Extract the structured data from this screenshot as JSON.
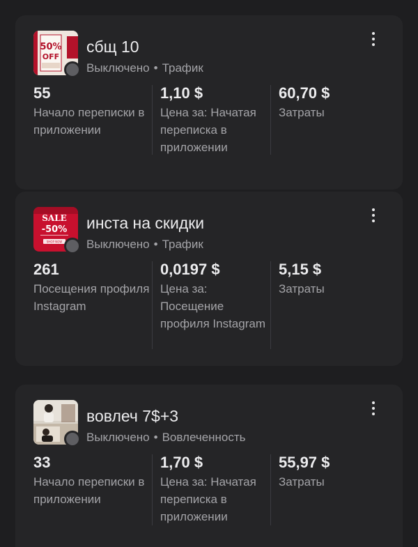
{
  "campaigns": [
    {
      "name": "сбщ 10",
      "status": "Выключено",
      "objective": "Трафик",
      "thumbnail_text": [
        "50%",
        "OFF"
      ],
      "metrics": [
        {
          "value": "55",
          "label": "Начало переписки в приложении"
        },
        {
          "value": "1,10 $",
          "label": "Цена за: Начатая переписка в приложении"
        },
        {
          "value": "60,70 $",
          "label": "Затраты"
        }
      ]
    },
    {
      "name": "инста на скидки",
      "status": "Выключено",
      "objective": "Трафик",
      "thumbnail_text": [
        "SALE",
        "-50%",
        "SHOP NOW"
      ],
      "metrics": [
        {
          "value": "261",
          "label": "Посещения профиля Instagram"
        },
        {
          "value": "0,0197 $",
          "label": "Цена за: Посещение профиля Instagram"
        },
        {
          "value": "5,15 $",
          "label": "Затраты"
        }
      ]
    },
    {
      "name": "вовлеч 7$+3",
      "status": "Выключено",
      "objective": "Вовлеченность",
      "thumbnail_text": [],
      "metrics": [
        {
          "value": "33",
          "label": "Начало переписки в приложении"
        },
        {
          "value": "1,70 $",
          "label": "Цена за: Начатая переписка в приложении"
        },
        {
          "value": "55,97 $",
          "label": "Затраты"
        }
      ]
    }
  ],
  "separator": "•",
  "colors": {
    "background": "#1e1e20",
    "card": "#252527",
    "primary_text": "#ececee",
    "secondary_text": "#a4a4a8",
    "status_inactive": "#5e5e62",
    "sale_red": "#c8102e"
  },
  "icons": {
    "more": "vertical-ellipsis-icon",
    "status": "status-dot-icon"
  }
}
